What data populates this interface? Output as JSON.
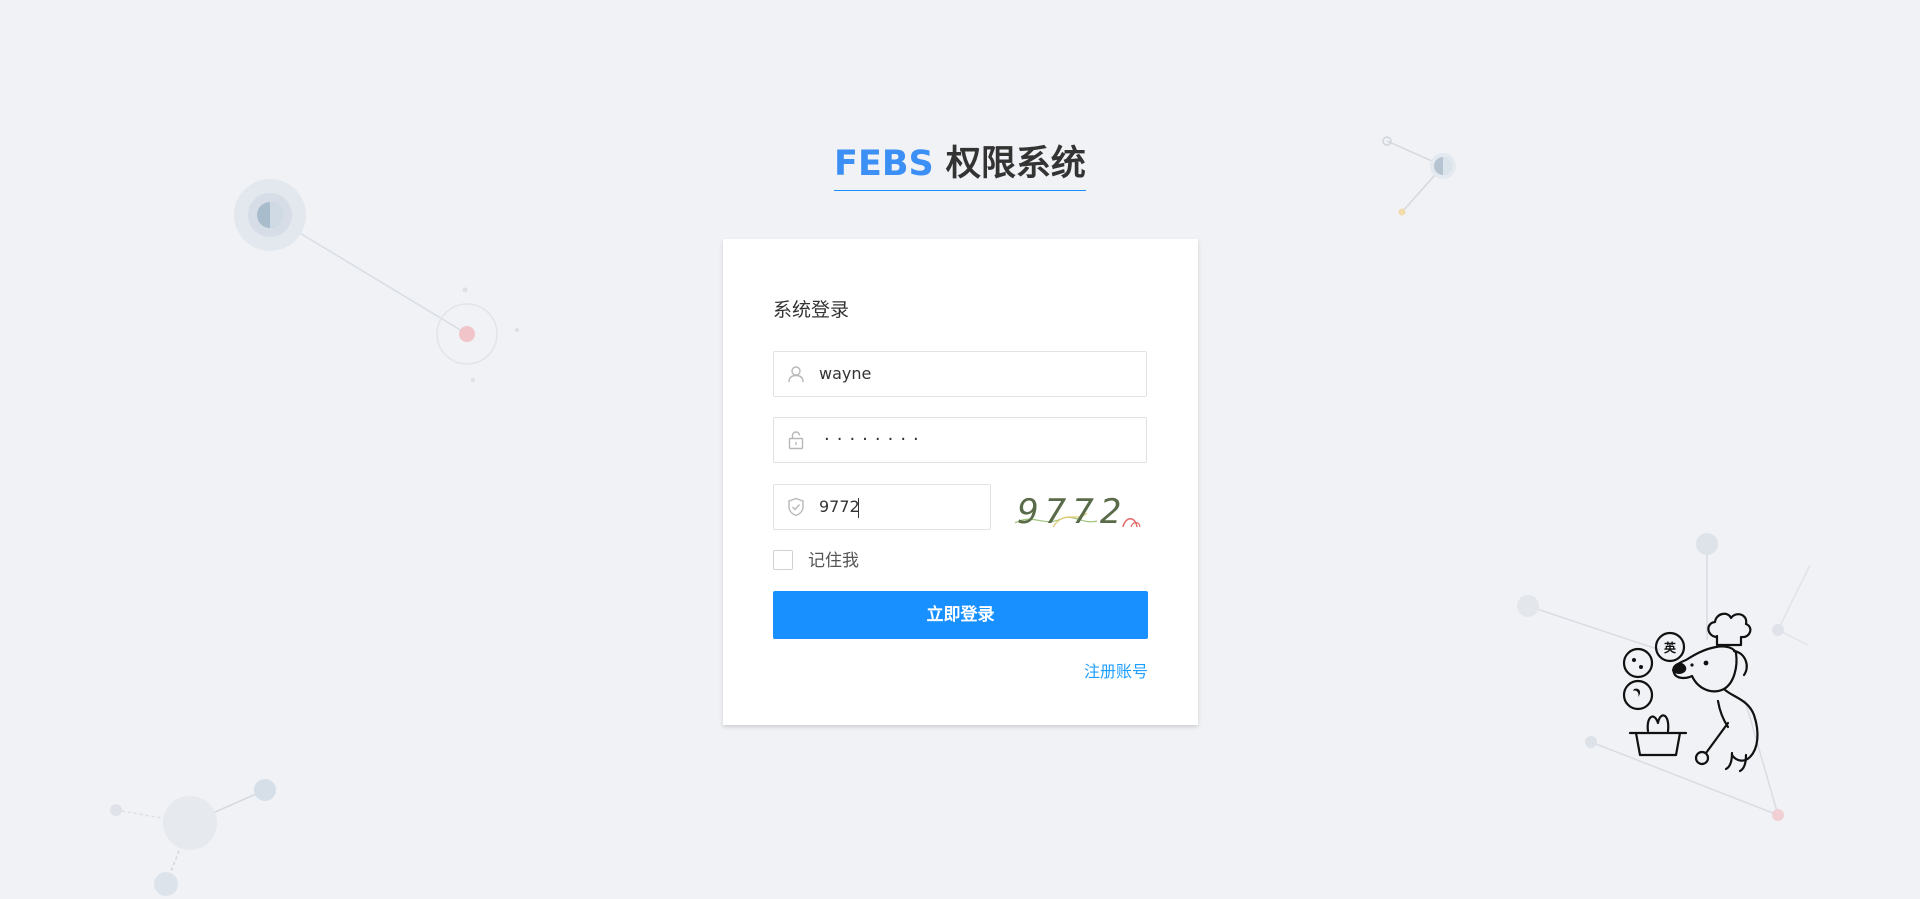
{
  "page": {
    "title_brand": "FEBS",
    "title_rest": " 权限系统"
  },
  "login": {
    "heading": "系统登录",
    "username_value": "wayne",
    "password_value": "········",
    "code_value": "9772",
    "captcha_text": "9772",
    "remember_label": "记住我",
    "submit_label": "立即登录",
    "register_label": "注册账号"
  },
  "mascot": {
    "badge_label": "英"
  },
  "icons": {
    "user": "user-icon",
    "lock": "lock-icon",
    "shield": "shield-check-icon"
  },
  "colors": {
    "background": "#f0f2f5",
    "primary": "#1890ff",
    "brand": "#3c8ff5",
    "link": "#1e9fff"
  }
}
